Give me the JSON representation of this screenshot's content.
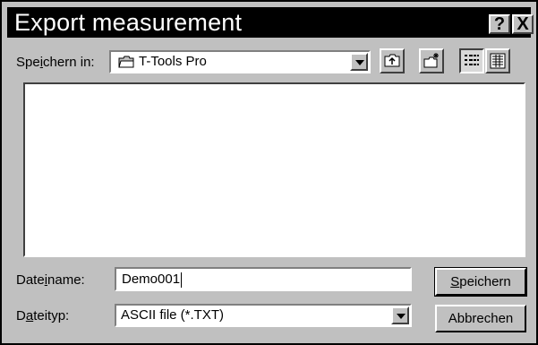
{
  "dialog": {
    "title": "Export measurement",
    "help_button": "?",
    "close_button": "X"
  },
  "save_in": {
    "label_pre": "Spe",
    "label_key": "i",
    "label_post": "chern in:",
    "value": "T-Tools Pro"
  },
  "toolbar": {
    "up_folder": "up-folder-icon",
    "new_folder": "new-folder-icon",
    "list_view": "list-view-icon",
    "details_view": "details-view-icon"
  },
  "filename": {
    "label_pre": "Date",
    "label_key": "i",
    "label_post": "name:",
    "value": "Demo001"
  },
  "filetype": {
    "label_pre": "D",
    "label_key": "a",
    "label_post": "teityp:",
    "value": "ASCII file (*.TXT)"
  },
  "buttons": {
    "save_key": "S",
    "save_rest": "peichern",
    "cancel": "Abbrechen"
  }
}
